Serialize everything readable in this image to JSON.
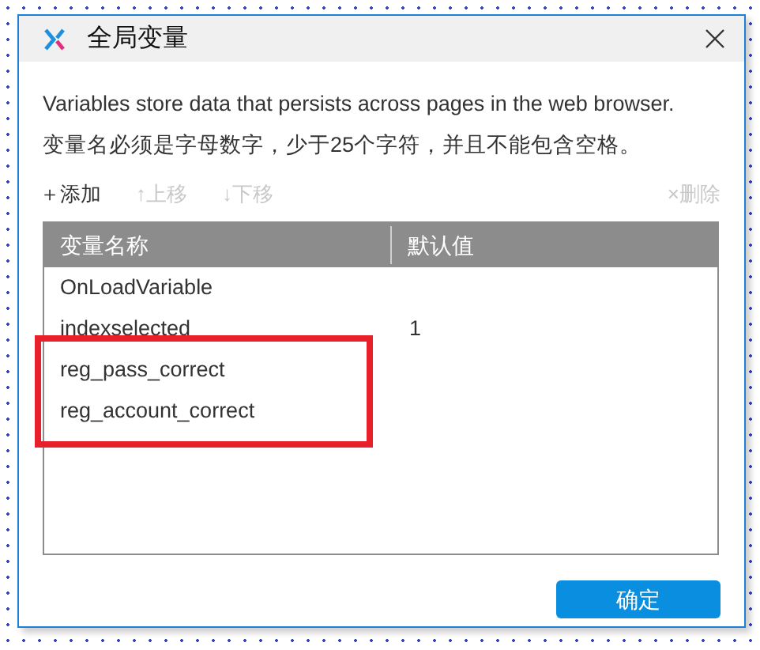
{
  "window": {
    "title": "全局变量"
  },
  "description": [
    "Variables store data that persists across pages in the web browser.",
    "变量名必须是字母数字，少于25个字符，并且不能包含空格。"
  ],
  "toolbar": [
    {
      "kind": "add",
      "icon": "＋",
      "label": "添加",
      "disabled": false
    },
    {
      "kind": "up",
      "icon": "↑",
      "label": "上移",
      "disabled": true
    },
    {
      "kind": "down",
      "icon": "↓",
      "label": "下移",
      "disabled": true
    },
    {
      "kind": "delete",
      "icon": "×",
      "label": "删除",
      "disabled": true
    }
  ],
  "table": {
    "columns": [
      "变量名称",
      "默认值"
    ],
    "rows": [
      {
        "name": "OnLoadVariable",
        "highlighted": false
      },
      {
        "name": "indexselected",
        "default": "1",
        "highlighted": false
      },
      {
        "name": "reg_pass_correct",
        "highlighted": true
      },
      {
        "name": "reg_account_correct",
        "highlighted": true
      }
    ]
  },
  "buttons": [
    "确定"
  ]
}
